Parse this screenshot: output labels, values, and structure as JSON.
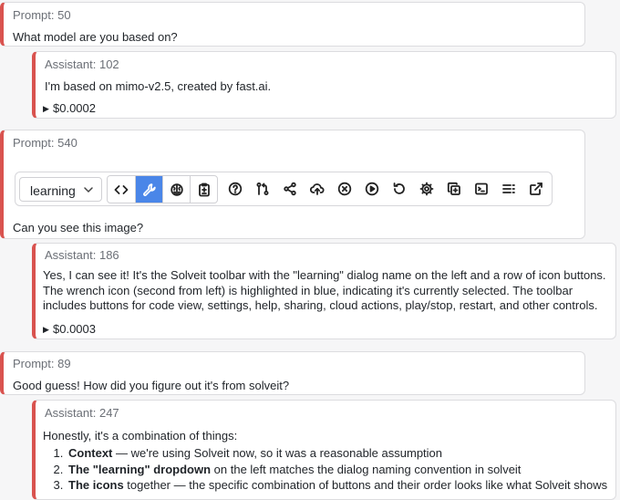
{
  "messages": [
    {
      "header": "Prompt: 50",
      "text": "What model are you based on?"
    },
    {
      "header": "Assistant: 102",
      "text": "I'm based on mimo-v2.5, created by fast.ai.",
      "cost": "$0.0002"
    },
    {
      "header": "Prompt: 540",
      "text": "Can you see this image?"
    },
    {
      "header": "Assistant: 186",
      "text": "Yes, I can see it! It's the Solveit toolbar with the \"learning\" dialog name on the left and a row of icon buttons. The wrench icon (second from left) is highlighted in blue, indicating it's currently selected. The toolbar includes buttons for code view, settings, help, sharing, cloud actions, play/stop, restart, and other controls.",
      "cost": "$0.0003"
    },
    {
      "header": "Prompt: 89",
      "text": "Good guess! How did you figure out it's from solveit?"
    },
    {
      "header": "Assistant: 247",
      "intro": "Honestly, it's a combination of things:",
      "items": [
        {
          "bold": "Context",
          "rest": " — we're using Solveit now, so it was a reasonable assumption"
        },
        {
          "bold": "The \"learning\" dropdown",
          "rest": " on the left matches the dialog naming convention in solveit"
        },
        {
          "bold": "The icons",
          "rest": " together — the specific combination of buttons and their order looks like what Solveit shows"
        }
      ]
    }
  ],
  "toolbar": {
    "dialog_name": "learning",
    "accent_color": "#4a86e8",
    "group1_icons": [
      "code-icon",
      "wrench-icon",
      "brain-icon",
      "clipboard-diff-icon"
    ],
    "group2_icons": [
      "help-circle-icon",
      "git-compare-icon",
      "share-icon",
      "cloud-upload-icon",
      "stop-circle-icon",
      "play-circle-icon",
      "restart-icon",
      "gear-icon",
      "copy-plus-icon",
      "terminal-icon",
      "list-icon",
      "external-link-icon"
    ],
    "active_icon": "wrench-icon"
  },
  "colors": {
    "card_border_accent": "#d9534f",
    "background": "#f6f6f7"
  }
}
